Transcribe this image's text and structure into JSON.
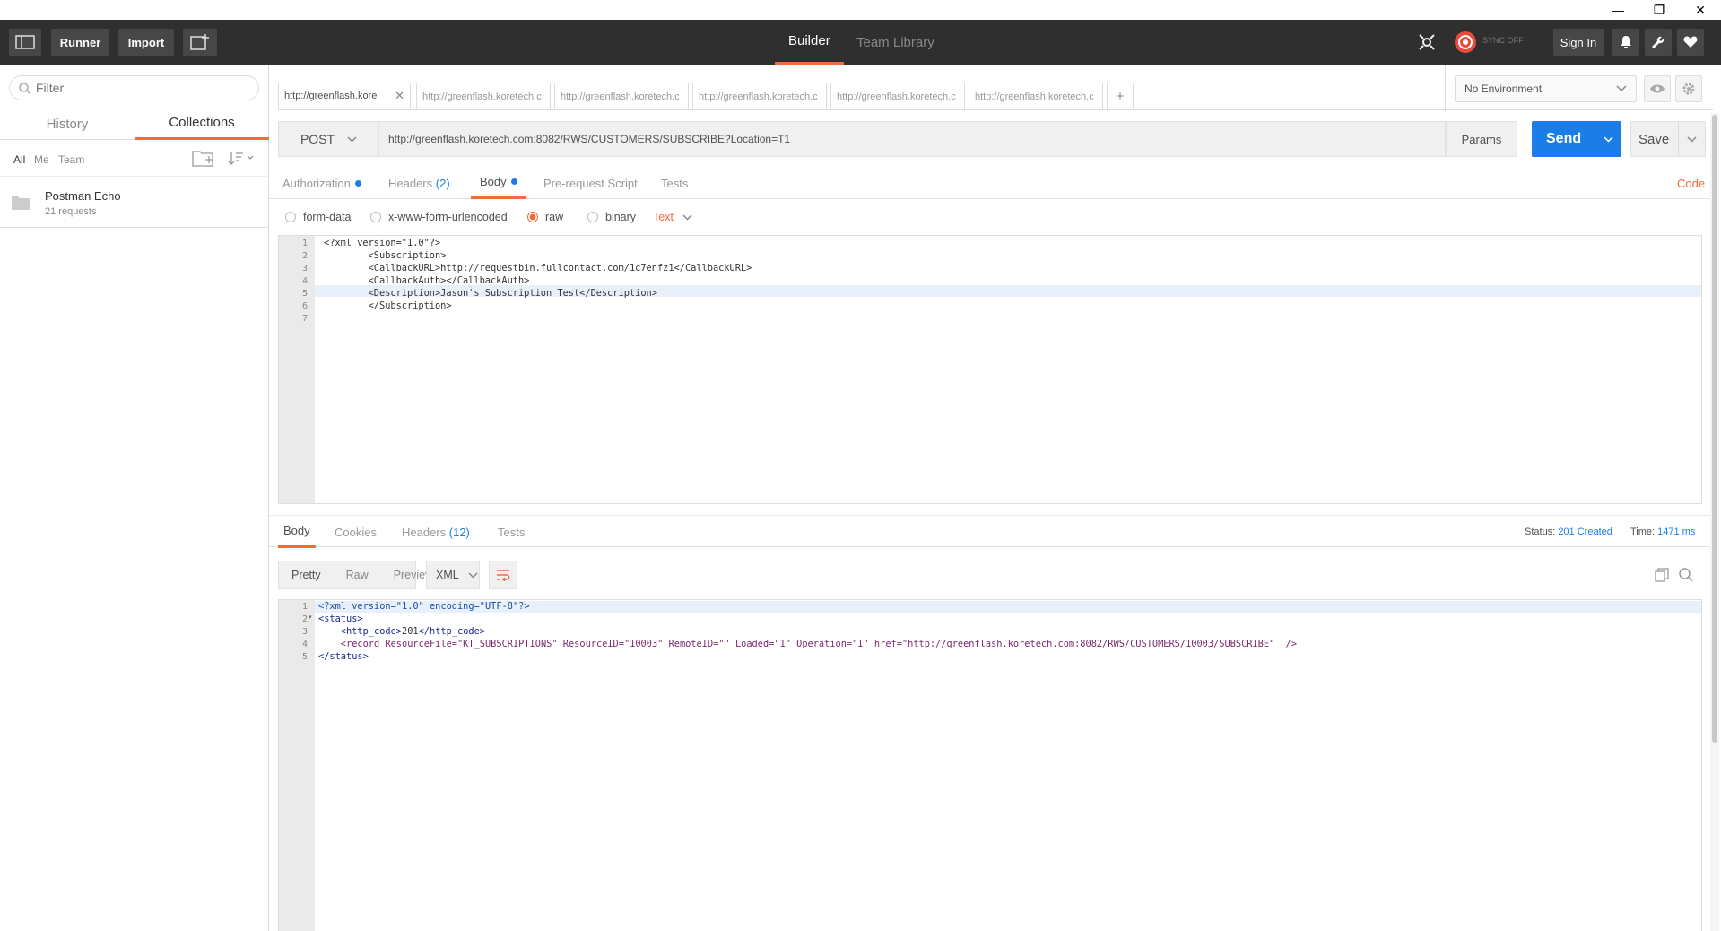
{
  "window": {
    "minimize": "—",
    "restore": "❐",
    "close": "✕"
  },
  "header": {
    "runner": "Runner",
    "import": "Import",
    "tabs": {
      "builder": "Builder",
      "team_library": "Team Library"
    },
    "sync": "SYNC OFF",
    "sign_in": "Sign In"
  },
  "sidebar": {
    "filter_placeholder": "Filter",
    "tabs": {
      "history": "History",
      "collections": "Collections"
    },
    "filters": {
      "all": "All",
      "me": "Me",
      "team": "Team"
    },
    "collection": {
      "name": "Postman Echo",
      "count": "21 requests"
    }
  },
  "request_tabs": [
    "http://greenflash.kore",
    "http://greenflash.koretech.c",
    "http://greenflash.koretech.c",
    "http://greenflash.koretech.c",
    "http://greenflash.koretech.c",
    "http://greenflash.koretech.c"
  ],
  "add_tab": "+",
  "environment": "No Environment",
  "request": {
    "method": "POST",
    "url": "http://greenflash.koretech.com:8082/RWS/CUSTOMERS/SUBSCRIBE?Location=T1",
    "params": "Params",
    "send": "Send",
    "save": "Save"
  },
  "req_tabs": {
    "authorization": "Authorization",
    "headers": "Headers",
    "headers_count": "(2)",
    "body": "Body",
    "prerequest": "Pre-request Script",
    "tests": "Tests",
    "code": "Code"
  },
  "body_options": {
    "form_data": "form-data",
    "urlencoded": "x-www-form-urlencoded",
    "raw": "raw",
    "binary": "binary",
    "type": "Text"
  },
  "request_body": [
    "<?xml version=\"1.0\"?>",
    "        <Subscription>",
    "        <CallbackURL>http://requestbin.fullcontact.com/1c7enfz1</CallbackURL>",
    "        <CallbackAuth></CallbackAuth>",
    "        <Description>Jason's Subscription Test</Description>",
    "        </Subscription>",
    ""
  ],
  "line_numbers": [
    "1",
    "2",
    "3",
    "4",
    "5",
    "6",
    "7"
  ],
  "response_tabs": {
    "body": "Body",
    "cookies": "Cookies",
    "headers": "Headers",
    "headers_count": "(12)",
    "tests": "Tests"
  },
  "response_meta": {
    "status_label": "Status:",
    "status_value": "201 Created",
    "time_label": "Time:",
    "time_value": "1471 ms"
  },
  "response_view": {
    "pretty": "Pretty",
    "raw": "Raw",
    "preview": "Preview",
    "format": "XML"
  },
  "response_lines": {
    "l1": "<?xml version=\"1.0\" encoding=\"UTF-8\"?>",
    "l2": "<status>",
    "l3_open": "    <http_code>",
    "l3_val": "201",
    "l3_close": "</http_code>",
    "l4": "    <record ResourceFile=\"KT_SUBSCRIPTIONS\" ResourceID=\"10003\" RemoteID=\"\" Loaded=\"1\" Operation=\"I\" href=\"http://greenflash.koretech.com:8082/RWS/CUSTOMERS/10003/SUBSCRIBE\"  />",
    "l5": "</status>"
  },
  "response_line_numbers": [
    "1",
    "2",
    "3",
    "4",
    "5"
  ],
  "colors": {
    "accent": "#f26b3a",
    "send": "#1b7ee8",
    "header_bg": "#2f2f2f"
  }
}
